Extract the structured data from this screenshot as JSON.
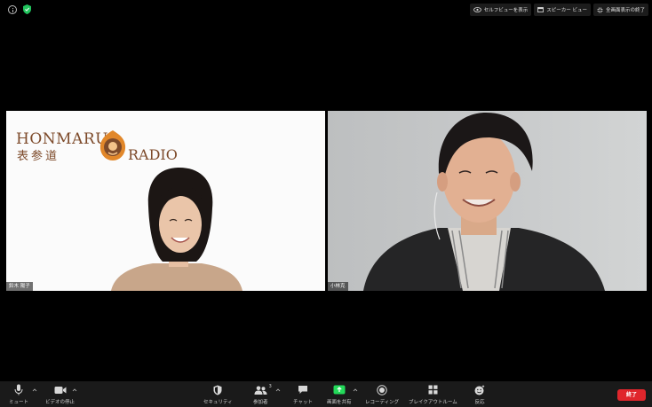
{
  "top_bar": {
    "buttons": [
      {
        "label": "セルフビューを表示",
        "icon": "eye-icon"
      },
      {
        "label": "スピーカー ビュー",
        "icon": "speaker-view-icon"
      },
      {
        "label": "全画面表示の終了",
        "icon": "exit-fullscreen-icon"
      }
    ]
  },
  "tiles": [
    {
      "name": "鈴木 陽子",
      "background_logo": {
        "line1": "HONMARU",
        "line2": "RADIO",
        "jp": "表参道"
      }
    },
    {
      "name": "小林克"
    }
  ],
  "toolbar": {
    "items": [
      {
        "label": "ミュート",
        "icon": "microphone-icon"
      },
      {
        "label": "ビデオの停止",
        "icon": "video-camera-icon"
      },
      {
        "label": "セキュリティ",
        "icon": "security-shield-icon"
      },
      {
        "label": "参加者",
        "icon": "participants-icon",
        "count": "3"
      },
      {
        "label": "チャット",
        "icon": "chat-icon"
      },
      {
        "label": "画面を共有",
        "icon": "share-screen-icon"
      },
      {
        "label": "レコーディング",
        "icon": "record-icon"
      },
      {
        "label": "ブレイクアウトルーム",
        "icon": "breakout-rooms-icon"
      },
      {
        "label": "反応",
        "icon": "reactions-icon"
      }
    ],
    "end_label": "終了"
  },
  "colors": {
    "share_green": "#23d959",
    "end_red": "#e0262c",
    "logo_brown": "#7d4a2a",
    "secure_green": "#21c45d"
  }
}
